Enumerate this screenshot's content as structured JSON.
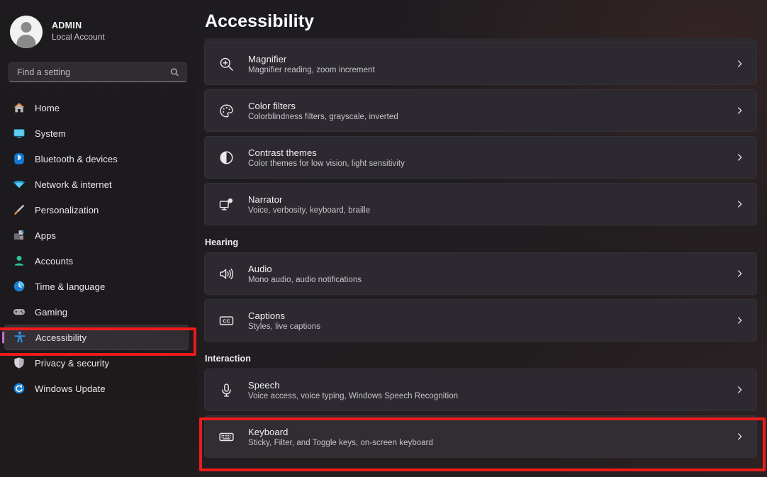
{
  "account": {
    "name": "ADMIN",
    "type": "Local Account",
    "avatar_icon": "person-avatar-icon"
  },
  "search": {
    "placeholder": "Find a setting",
    "value": "",
    "icon": "search-icon"
  },
  "sidebar": {
    "items": [
      {
        "label": "Home",
        "icon": "home-icon",
        "selected": false
      },
      {
        "label": "System",
        "icon": "system-monitor-icon",
        "selected": false
      },
      {
        "label": "Bluetooth & devices",
        "icon": "bluetooth-icon",
        "selected": false
      },
      {
        "label": "Network & internet",
        "icon": "wifi-icon",
        "selected": false
      },
      {
        "label": "Personalization",
        "icon": "paintbrush-icon",
        "selected": false
      },
      {
        "label": "Apps",
        "icon": "apps-blocks-icon",
        "selected": false
      },
      {
        "label": "Accounts",
        "icon": "account-person-icon",
        "selected": false
      },
      {
        "label": "Time & language",
        "icon": "clock-icon",
        "selected": false
      },
      {
        "label": "Gaming",
        "icon": "gamepad-icon",
        "selected": false
      },
      {
        "label": "Accessibility",
        "icon": "accessibility-person-icon",
        "selected": true
      },
      {
        "label": "Privacy & security",
        "icon": "shield-icon",
        "selected": false
      },
      {
        "label": "Windows Update",
        "icon": "update-refresh-icon",
        "selected": false
      }
    ]
  },
  "main": {
    "title": "Accessibility",
    "sections": [
      {
        "heading": "",
        "cards": [
          {
            "title": "Magnifier",
            "subtitle": "Magnifier reading, zoom increment",
            "icon": "magnifier-icon",
            "highlighted": false
          },
          {
            "title": "Color filters",
            "subtitle": "Colorblindness filters, grayscale, inverted",
            "icon": "color-palette-icon",
            "highlighted": false
          },
          {
            "title": "Contrast themes",
            "subtitle": "Color themes for low vision, light sensitivity",
            "icon": "contrast-circle-icon",
            "highlighted": false
          },
          {
            "title": "Narrator",
            "subtitle": "Voice, verbosity, keyboard, braille",
            "icon": "narrator-monitor-icon",
            "highlighted": false
          }
        ]
      },
      {
        "heading": "Hearing",
        "cards": [
          {
            "title": "Audio",
            "subtitle": "Mono audio, audio notifications",
            "icon": "speaker-icon",
            "highlighted": false
          },
          {
            "title": "Captions",
            "subtitle": "Styles, live captions",
            "icon": "captions-cc-icon",
            "highlighted": false
          }
        ]
      },
      {
        "heading": "Interaction",
        "cards": [
          {
            "title": "Speech",
            "subtitle": "Voice access, voice typing, Windows Speech Recognition",
            "icon": "microphone-icon",
            "highlighted": false
          },
          {
            "title": "Keyboard",
            "subtitle": "Sticky, Filter, and Toggle keys, on-screen keyboard",
            "icon": "keyboard-icon",
            "highlighted": true
          }
        ]
      }
    ],
    "chevron_icon": "chevron-right-icon"
  },
  "annotations": [
    {
      "name": "accessibility-highlight",
      "target": "sidebar-item-accessibility",
      "color": "#ee1b1b"
    },
    {
      "name": "keyboard-highlight",
      "target": "card-keyboard",
      "color": "#ee1b1b"
    }
  ],
  "colors": {
    "accent_selection": "#c46ecf",
    "annotation_red": "#ee1b1b",
    "card_bg": "#2c2a30",
    "sidebar_bg": "#1d1b1e"
  }
}
